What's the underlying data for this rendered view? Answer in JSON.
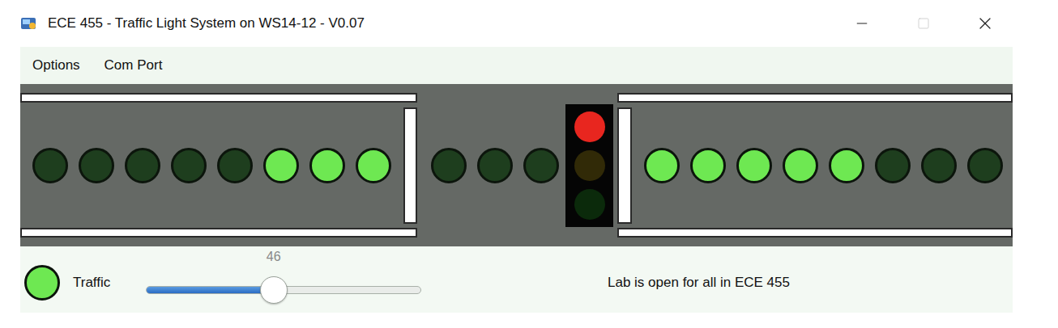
{
  "window": {
    "title": "ECE 455 - Traffic Light System on WS14-12 - V0.07"
  },
  "menu": [
    "Options",
    "Com Port"
  ],
  "road": {
    "left_lane": [
      {
        "on": false
      },
      {
        "on": false
      },
      {
        "on": false
      },
      {
        "on": false
      },
      {
        "on": false
      },
      {
        "on": true
      },
      {
        "on": true
      },
      {
        "on": true
      }
    ],
    "intersection": [
      {
        "on": false
      },
      {
        "on": false
      },
      {
        "on": false
      }
    ],
    "right_lane": [
      {
        "on": true
      },
      {
        "on": true
      },
      {
        "on": true
      },
      {
        "on": true
      },
      {
        "on": true
      },
      {
        "on": false
      },
      {
        "on": false
      },
      {
        "on": false
      }
    ]
  },
  "traffic_light": [
    {
      "on": true,
      "color": "#e8261f"
    },
    {
      "on": false,
      "color": "#e0c020"
    },
    {
      "on": false,
      "color": "#30c030"
    }
  ],
  "traffic": {
    "label": "Traffic",
    "on": true
  },
  "slider": {
    "value": "46",
    "level": 0.46
  },
  "status": "Lab is open for all in ECE 455"
}
